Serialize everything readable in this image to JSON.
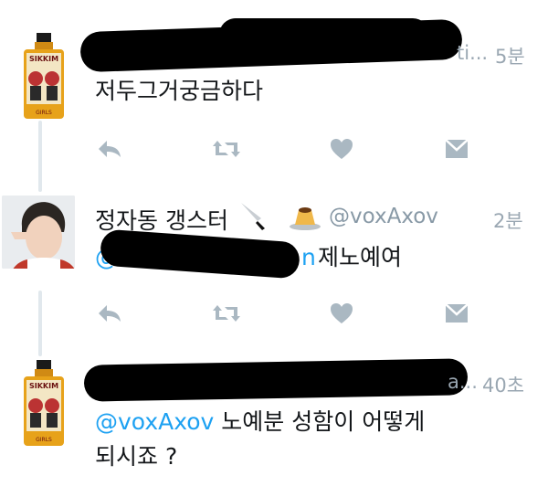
{
  "colors": {
    "accent": "#1da1f2",
    "icon": "#aab8c2",
    "text": "#14171a",
    "meta": "#9aa7b2"
  },
  "tweets": [
    {
      "time": "5분",
      "name_fragment": "ti...",
      "text": "저두그거궁금하다",
      "avatar": "hot-sauce-bottle",
      "bottle_label": "SIKKIM",
      "bottle_sub": "GIRLS"
    },
    {
      "name": "정자동 갱스터",
      "emoji": [
        "knife-emoji",
        "pudding-emoji"
      ],
      "handle": "@voxAxov",
      "time": "2분",
      "mention_fragment": "@",
      "mention_tail": "n",
      "text": "제노예여",
      "avatar": "person-photo"
    },
    {
      "time": "40초",
      "name_fragment": "a...",
      "mention": "@voxAxov",
      "text_line1": "노예분 성함이 어떻게",
      "text_line2": "되시죠 ?",
      "avatar": "hot-sauce-bottle",
      "bottle_label": "SIKKIM",
      "bottle_sub": "GIRLS"
    }
  ],
  "actions": [
    "reply-icon",
    "retweet-icon",
    "like-icon",
    "dm-icon"
  ]
}
